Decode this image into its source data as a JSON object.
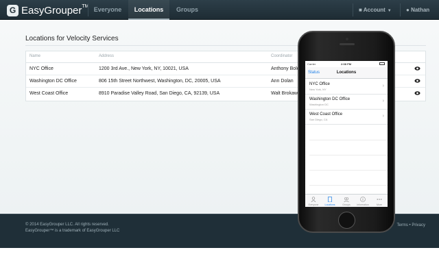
{
  "app": {
    "brand": "EasyGrouper",
    "brand_tm": "TM",
    "logo_letter": "G"
  },
  "nav": {
    "items": [
      {
        "label": "Everyone",
        "active": false
      },
      {
        "label": "Locations",
        "active": true
      },
      {
        "label": "Groups",
        "active": false
      }
    ],
    "account_label": "Account",
    "user_label": "Nathan"
  },
  "page": {
    "title": "Locations for Velocity Services"
  },
  "table": {
    "headers": [
      "Name",
      "Address",
      "Coordinator"
    ],
    "rows": [
      {
        "name": "NYC Office",
        "address": "1200 3rd Ave., New York, NY, 10021, USA",
        "coordinator": "Anthony Bolo"
      },
      {
        "name": "Washington DC Office",
        "address": "806 15th Street Northwest, Washington, DC, 20005, USA",
        "coordinator": "Ann Dolan"
      },
      {
        "name": "West Coast Office",
        "address": "8910 Paradise Valley Road, San Diego, CA, 92139, USA",
        "coordinator": "Walt Brokaw"
      }
    ]
  },
  "footer": {
    "copyright": "© 2014 EasyGrouper LLC. All rights reserved.",
    "trademark": "EasyGrouper™ is a trademark of EasyGrouper LLC",
    "links": [
      "Terms",
      "Privacy"
    ]
  },
  "phone": {
    "carrier": "Carrier",
    "time": "2:08 PM",
    "back_label": "Status",
    "title": "Locations",
    "cells": [
      {
        "title": "NYC Office",
        "subtitle": "New York, NY"
      },
      {
        "title": "Washington DC Office",
        "subtitle": "Washington DC"
      },
      {
        "title": "West Coast Office",
        "subtitle": "San Diego, CA"
      }
    ],
    "tabs": [
      {
        "label": "Everyone",
        "icon": "person-icon",
        "active": false
      },
      {
        "label": "Locations",
        "icon": "building-icon",
        "active": true
      },
      {
        "label": "Groups",
        "icon": "group-icon",
        "active": false
      },
      {
        "label": "Information",
        "icon": "info-icon",
        "active": false
      },
      {
        "label": "More",
        "icon": "more-icon",
        "active": false
      }
    ]
  },
  "colors": {
    "navbar": "#1e2c34",
    "footer": "#1f2f38",
    "ios_blue": "#1a7ee6"
  }
}
